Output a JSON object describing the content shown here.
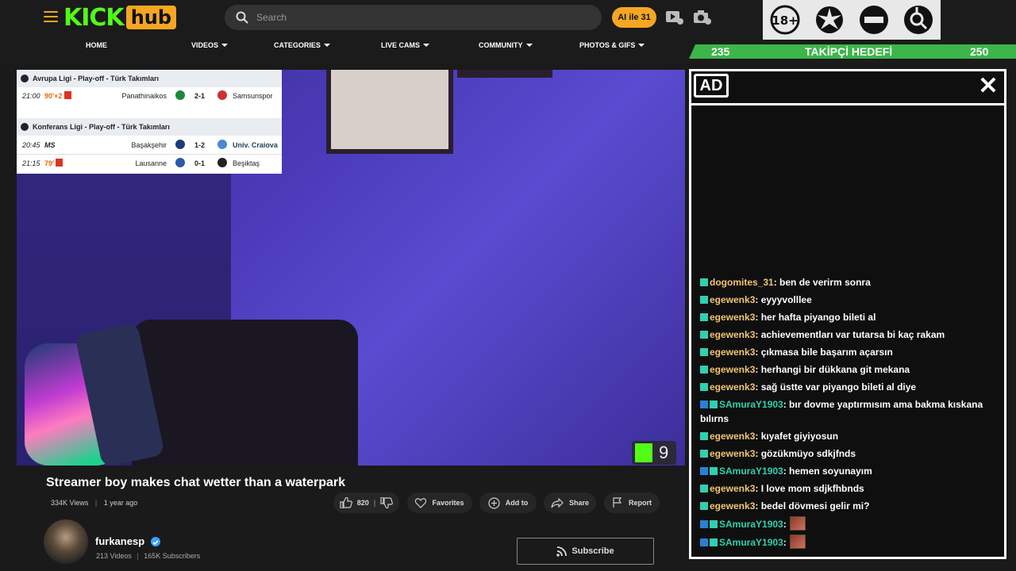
{
  "header": {
    "logo_kick": "KICK",
    "logo_hub": "hub",
    "search_placeholder": "Search",
    "ai_button": "AI ile 31",
    "nav": [
      {
        "label": "HOME",
        "caret": false
      },
      {
        "label": "VIDEOS",
        "caret": true
      },
      {
        "label": "CATEGORIES",
        "caret": true
      },
      {
        "label": "LIVE CAMS",
        "caret": true
      },
      {
        "label": "COMMUNITY",
        "caret": true
      },
      {
        "label": "PHOTOS & GIFS",
        "caret": true
      }
    ]
  },
  "badges": {
    "age": "18+",
    "icons": [
      "age-18-plus-icon",
      "sparkle-icon",
      "no-entry-icon",
      "gender-search-icon"
    ]
  },
  "goal": {
    "current": "235",
    "label": "TAKİPÇİ HEDEFİ",
    "target": "250",
    "color": "#3cb54a"
  },
  "scores": {
    "group1": {
      "title": "Avrupa Ligi - Play-off - Türk Takımları",
      "matches": [
        {
          "time": "21:00",
          "status": "90'+2",
          "home": "Panathinaikos",
          "score": "2-1",
          "away": "Samsunspor"
        }
      ]
    },
    "group2": {
      "title": "Konferans Ligi - Play-off - Türk Takımları",
      "matches": [
        {
          "time": "20:45",
          "status": "MS",
          "home": "Başakşehir",
          "score": "1-2",
          "away": "Univ. Craiova"
        },
        {
          "time": "21:15",
          "status": "79'",
          "home": "Lausanne",
          "score": "0-1",
          "away": "Beşiktaş"
        }
      ]
    }
  },
  "video": {
    "title": "Streamer boy makes chat wetter than a waterpark",
    "views": "334K Views",
    "age": "1 year ago",
    "kick_viewers": "9",
    "likes": "820"
  },
  "actions": {
    "favorites": "Favorites",
    "add_to": "Add to",
    "share": "Share",
    "report": "Report"
  },
  "channel": {
    "name": "furkanesp",
    "videos": "213 Videos",
    "subscribers": "165K Subscribers",
    "subscribe": "Subscribe"
  },
  "ad": {
    "label": "AD",
    "close": "✕"
  },
  "chat": [
    {
      "user": "dogomites_31",
      "text": ": ben de verirm sonra",
      "badge": "g",
      "alt": false
    },
    {
      "user": "egewenk3",
      "text": ": eyyyvolllee",
      "badge": "g",
      "alt": false
    },
    {
      "user": "egewenk3",
      "text": ": her hafta piyango bileti al",
      "badge": "g",
      "alt": false
    },
    {
      "user": "egewenk3",
      "text": ": achievementları var tutarsa bi kaç rakam",
      "badge": "g",
      "alt": false
    },
    {
      "user": "egewenk3",
      "text": ": çıkmasa bile başarım açarsın",
      "badge": "g",
      "alt": false
    },
    {
      "user": "egewenk3",
      "text": ": herhangi bir dükkana git mekana",
      "badge": "g",
      "alt": false
    },
    {
      "user": "egewenk3",
      "text": ": sağ üstte var piyango bileti al diye",
      "badge": "g",
      "alt": false
    },
    {
      "user": "SAmuraY1903",
      "text": ": bır dovme yaptırmısım ama bakma kıskana bılırns",
      "badge": "b",
      "alt": true
    },
    {
      "user": "egewenk3",
      "text": ": kıyafet giyiyosun",
      "badge": "g",
      "alt": false
    },
    {
      "user": "egewenk3",
      "text": ": gözükmüyo sdkjfnds",
      "badge": "g",
      "alt": false
    },
    {
      "user": "SAmuraY1903",
      "text": ": hemen soyunayım",
      "badge": "b",
      "alt": true
    },
    {
      "user": "egewenk3",
      "text": ": I love mom sdjkfhbnds",
      "badge": "g",
      "alt": false
    },
    {
      "user": "egewenk3",
      "text": ": bedel dövmesi gelir mi?",
      "badge": "g",
      "alt": false
    },
    {
      "user": "SAmuraY1903",
      "text": ":",
      "badge": "b",
      "alt": true,
      "emote": true
    },
    {
      "user": "SAmuraY1903",
      "text": ":",
      "badge": "b",
      "alt": true,
      "emote": true
    }
  ]
}
